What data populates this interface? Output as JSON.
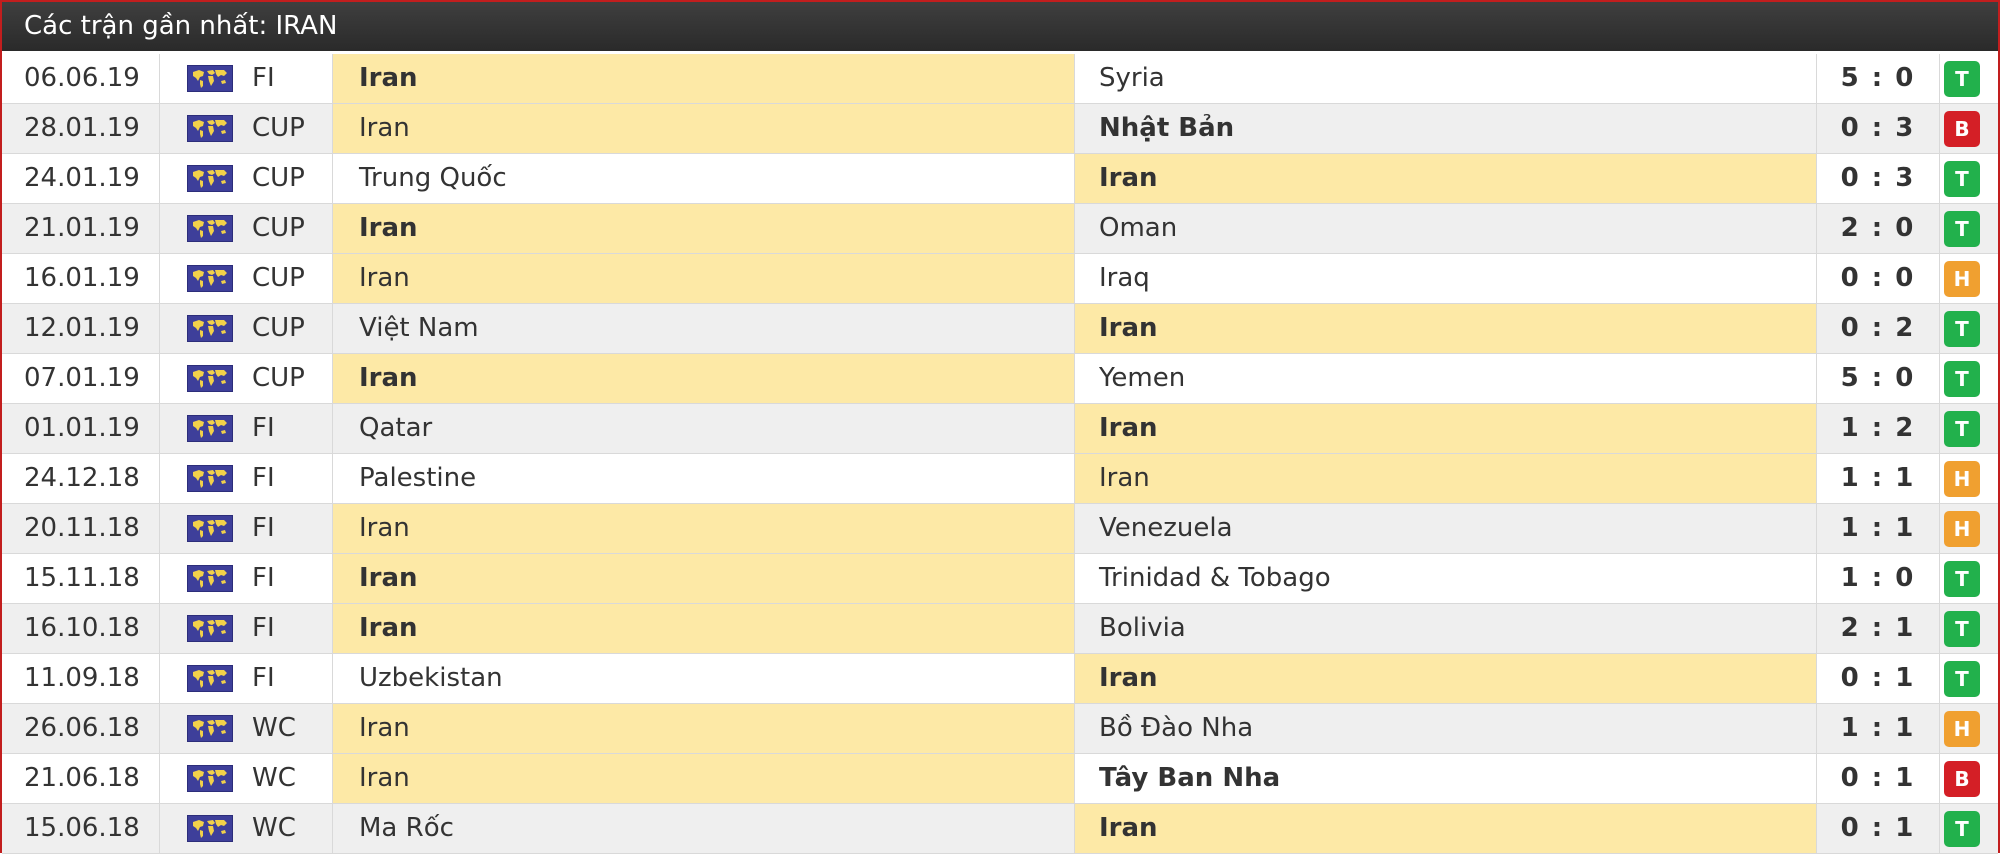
{
  "header": {
    "title": "Các trận gần nhất: IRAN"
  },
  "colors": {
    "T": "#22b14c",
    "B": "#d41f26",
    "H": "#f0a030",
    "highlight": "#fde9a6",
    "flag": "#3e3f9a"
  },
  "flag_icon": "world-map-flag-icon",
  "matches": [
    {
      "date": "06.06.19",
      "league": "FI",
      "home": "Iran",
      "away": "Syria",
      "score": "5 : 0",
      "result": "T",
      "home_hl": true,
      "away_hl": false,
      "home_bold": true,
      "away_bold": false
    },
    {
      "date": "28.01.19",
      "league": "CUP",
      "home": "Iran",
      "away": "Nhật Bản",
      "score": "0 : 3",
      "result": "B",
      "home_hl": true,
      "away_hl": false,
      "home_bold": false,
      "away_bold": true
    },
    {
      "date": "24.01.19",
      "league": "CUP",
      "home": "Trung Quốc",
      "away": "Iran",
      "score": "0 : 3",
      "result": "T",
      "home_hl": false,
      "away_hl": true,
      "home_bold": false,
      "away_bold": true
    },
    {
      "date": "21.01.19",
      "league": "CUP",
      "home": "Iran",
      "away": "Oman",
      "score": "2 : 0",
      "result": "T",
      "home_hl": true,
      "away_hl": false,
      "home_bold": true,
      "away_bold": false
    },
    {
      "date": "16.01.19",
      "league": "CUP",
      "home": "Iran",
      "away": "Iraq",
      "score": "0 : 0",
      "result": "H",
      "home_hl": true,
      "away_hl": false,
      "home_bold": false,
      "away_bold": false
    },
    {
      "date": "12.01.19",
      "league": "CUP",
      "home": "Việt Nam",
      "away": "Iran",
      "score": "0 : 2",
      "result": "T",
      "home_hl": false,
      "away_hl": true,
      "home_bold": false,
      "away_bold": true
    },
    {
      "date": "07.01.19",
      "league": "CUP",
      "home": "Iran",
      "away": "Yemen",
      "score": "5 : 0",
      "result": "T",
      "home_hl": true,
      "away_hl": false,
      "home_bold": true,
      "away_bold": false
    },
    {
      "date": "01.01.19",
      "league": "FI",
      "home": "Qatar",
      "away": "Iran",
      "score": "1 : 2",
      "result": "T",
      "home_hl": false,
      "away_hl": true,
      "home_bold": false,
      "away_bold": true
    },
    {
      "date": "24.12.18",
      "league": "FI",
      "home": "Palestine",
      "away": "Iran",
      "score": "1 : 1",
      "result": "H",
      "home_hl": false,
      "away_hl": true,
      "home_bold": false,
      "away_bold": false
    },
    {
      "date": "20.11.18",
      "league": "FI",
      "home": "Iran",
      "away": "Venezuela",
      "score": "1 : 1",
      "result": "H",
      "home_hl": true,
      "away_hl": false,
      "home_bold": false,
      "away_bold": false
    },
    {
      "date": "15.11.18",
      "league": "FI",
      "home": "Iran",
      "away": "Trinidad & Tobago",
      "score": "1 : 0",
      "result": "T",
      "home_hl": true,
      "away_hl": false,
      "home_bold": true,
      "away_bold": false
    },
    {
      "date": "16.10.18",
      "league": "FI",
      "home": "Iran",
      "away": "Bolivia",
      "score": "2 : 1",
      "result": "T",
      "home_hl": true,
      "away_hl": false,
      "home_bold": true,
      "away_bold": false
    },
    {
      "date": "11.09.18",
      "league": "FI",
      "home": "Uzbekistan",
      "away": "Iran",
      "score": "0 : 1",
      "result": "T",
      "home_hl": false,
      "away_hl": true,
      "home_bold": false,
      "away_bold": true
    },
    {
      "date": "26.06.18",
      "league": "WC",
      "home": "Iran",
      "away": "Bồ Đào Nha",
      "score": "1 : 1",
      "result": "H",
      "home_hl": true,
      "away_hl": false,
      "home_bold": false,
      "away_bold": false
    },
    {
      "date": "21.06.18",
      "league": "WC",
      "home": "Iran",
      "away": "Tây Ban Nha",
      "score": "0 : 1",
      "result": "B",
      "home_hl": true,
      "away_hl": false,
      "home_bold": false,
      "away_bold": true
    },
    {
      "date": "15.06.18",
      "league": "WC",
      "home": "Ma Rốc",
      "away": "Iran",
      "score": "0 : 1",
      "result": "T",
      "home_hl": false,
      "away_hl": true,
      "home_bold": false,
      "away_bold": true
    }
  ]
}
